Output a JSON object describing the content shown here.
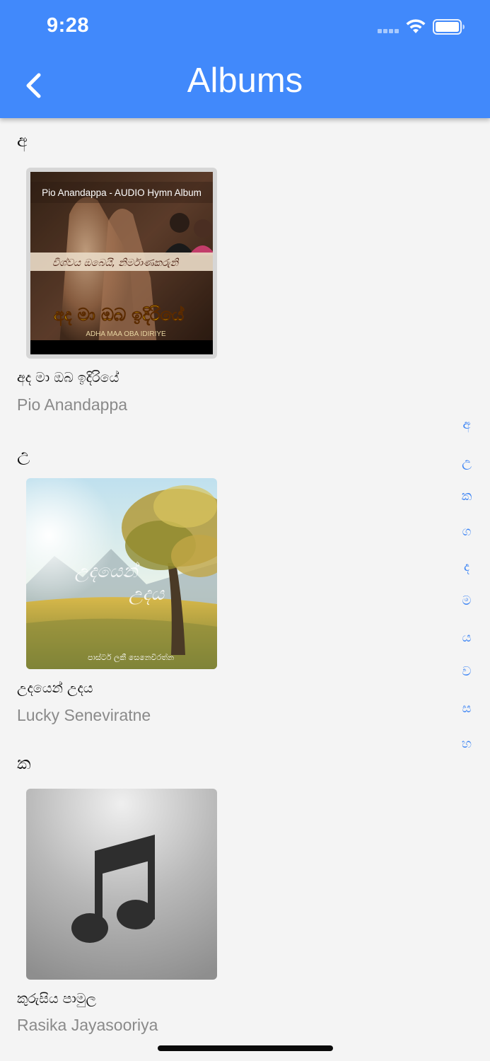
{
  "status_bar": {
    "time": "9:28",
    "icons": [
      "signal-icon",
      "wifi-icon",
      "battery-icon"
    ]
  },
  "header": {
    "title": "Albums",
    "back_icon": "chevron-left-icon",
    "background_color": "#4189fb"
  },
  "sections": [
    {
      "letter": "අ",
      "albums": [
        {
          "title": "අද මා ඔබ ඉදිරියේ",
          "artist": "Pio Anandappa",
          "cover_text": {
            "top": "Pio Anandappa - AUDIO Hymn Album",
            "subtitle": "විශ්වය ඔබෙයි, නිර්මාණකරුනි",
            "main": "අද මා ඔබ ඉදිරියේ",
            "romanized": "ADHA MAA OBA IDIRIYE"
          }
        }
      ]
    },
    {
      "letter": "උ",
      "albums": [
        {
          "title": "උදයෙන් උදය",
          "artist": "Lucky Seneviratne",
          "cover_text": {
            "main_line1": "උදයෙන්",
            "main_line2": "උදය",
            "credit": "පාස්ටර් ලකී සෙනෙවිරත්න"
          }
        }
      ]
    },
    {
      "letter": "ක",
      "albums": [
        {
          "title": "කුරුසිය පාමුල",
          "artist": "Rasika Jayasooriya",
          "cover_icon": "music-note-icon"
        }
      ]
    }
  ],
  "index_letters": [
    "අ",
    "උ",
    "ක",
    "ග",
    "ද",
    "ම",
    "ය",
    "ව",
    "ස",
    "හ"
  ],
  "accent_color": "#3f86f4"
}
